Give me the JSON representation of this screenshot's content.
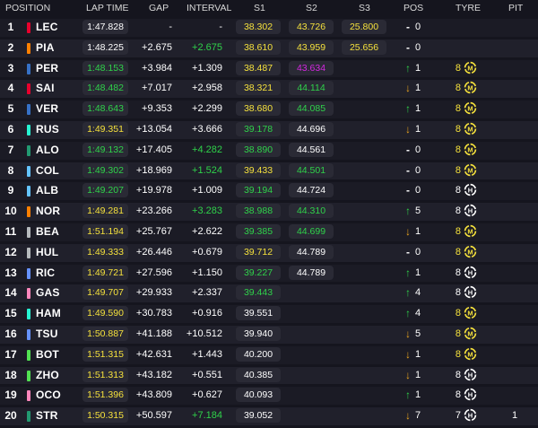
{
  "header": {
    "position": "POSITION",
    "lap_time": "LAP TIME",
    "gap": "GAP",
    "interval": "INTERVAL",
    "s1": "S1",
    "s2": "S2",
    "s3": "S3",
    "pos": "POS",
    "tyre": "TYRE",
    "pit": "PIT"
  },
  "colors": {
    "yellow": "#f5e13c",
    "green": "#2fd24a",
    "purple": "#d427e0",
    "white": "#ffffff",
    "orange": "#e8a31e"
  },
  "team_colors": {
    "ferrari": "#e8002d",
    "mclaren": "#ff8000",
    "redbull": "#3671c6",
    "mercedes": "#27f4d2",
    "aston": "#229971",
    "williams": "#64c4ff",
    "haas": "#b6babd",
    "rb": "#6692ff",
    "alpine": "#ff87bc",
    "sauber": "#52e252"
  },
  "rows": [
    {
      "pos": "1",
      "driver": "LEC",
      "team": "ferrari",
      "lap": "1:47.828",
      "lap_color": "white",
      "gap": "-",
      "gap_color": "white",
      "int": "-",
      "int_color": "white",
      "s1": "38.302",
      "s1_color": "yellow",
      "s2": "43.726",
      "s2_color": "yellow",
      "s3": "25.800",
      "s3_color": "yellow",
      "arrow": "-",
      "arrow_color": "white",
      "posn": "0",
      "tyre_age": "",
      "tyre": "",
      "pit": ""
    },
    {
      "pos": "2",
      "driver": "PIA",
      "team": "mclaren",
      "lap": "1:48.225",
      "lap_color": "white",
      "gap": "+2.675",
      "gap_color": "white",
      "int": "+2.675",
      "int_color": "green",
      "s1": "38.610",
      "s1_color": "yellow",
      "s2": "43.959",
      "s2_color": "yellow",
      "s3": "25.656",
      "s3_color": "yellow",
      "arrow": "-",
      "arrow_color": "white",
      "posn": "0",
      "tyre_age": "",
      "tyre": "",
      "pit": ""
    },
    {
      "pos": "3",
      "driver": "PER",
      "team": "redbull",
      "lap": "1:48.153",
      "lap_color": "green",
      "gap": "+3.984",
      "gap_color": "white",
      "int": "+1.309",
      "int_color": "white",
      "s1": "38.487",
      "s1_color": "yellow",
      "s2": "43.634",
      "s2_color": "purple",
      "s3": "",
      "s3_color": "white",
      "arrow": "↑",
      "arrow_color": "green",
      "posn": "1",
      "tyre_age": "8",
      "tyre": "M",
      "pit": ""
    },
    {
      "pos": "4",
      "driver": "SAI",
      "team": "ferrari",
      "lap": "1:48.482",
      "lap_color": "green",
      "gap": "+7.017",
      "gap_color": "white",
      "int": "+2.958",
      "int_color": "white",
      "s1": "38.321",
      "s1_color": "yellow",
      "s2": "44.114",
      "s2_color": "green",
      "s3": "",
      "s3_color": "white",
      "arrow": "↓",
      "arrow_color": "orange",
      "posn": "1",
      "tyre_age": "8",
      "tyre": "M",
      "pit": ""
    },
    {
      "pos": "5",
      "driver": "VER",
      "team": "redbull",
      "lap": "1:48.643",
      "lap_color": "green",
      "gap": "+9.353",
      "gap_color": "white",
      "int": "+2.299",
      "int_color": "white",
      "s1": "38.680",
      "s1_color": "yellow",
      "s2": "44.085",
      "s2_color": "green",
      "s3": "",
      "s3_color": "white",
      "arrow": "↑",
      "arrow_color": "green",
      "posn": "1",
      "tyre_age": "8",
      "tyre": "M",
      "pit": ""
    },
    {
      "pos": "6",
      "driver": "RUS",
      "team": "mercedes",
      "lap": "1:49.351",
      "lap_color": "yellow",
      "gap": "+13.054",
      "gap_color": "white",
      "int": "+3.666",
      "int_color": "white",
      "s1": "39.178",
      "s1_color": "green",
      "s2": "44.696",
      "s2_color": "white",
      "s3": "",
      "s3_color": "white",
      "arrow": "↓",
      "arrow_color": "orange",
      "posn": "1",
      "tyre_age": "8",
      "tyre": "M",
      "pit": ""
    },
    {
      "pos": "7",
      "driver": "ALO",
      "team": "aston",
      "lap": "1:49.132",
      "lap_color": "green",
      "gap": "+17.405",
      "gap_color": "white",
      "int": "+4.282",
      "int_color": "green",
      "s1": "38.890",
      "s1_color": "green",
      "s2": "44.561",
      "s2_color": "white",
      "s3": "",
      "s3_color": "white",
      "arrow": "-",
      "arrow_color": "white",
      "posn": "0",
      "tyre_age": "8",
      "tyre": "M",
      "pit": ""
    },
    {
      "pos": "8",
      "driver": "COL",
      "team": "williams",
      "lap": "1:49.302",
      "lap_color": "green",
      "gap": "+18.969",
      "gap_color": "white",
      "int": "+1.524",
      "int_color": "green",
      "s1": "39.433",
      "s1_color": "yellow",
      "s2": "44.501",
      "s2_color": "green",
      "s3": "",
      "s3_color": "white",
      "arrow": "-",
      "arrow_color": "white",
      "posn": "0",
      "tyre_age": "8",
      "tyre": "M",
      "pit": ""
    },
    {
      "pos": "9",
      "driver": "ALB",
      "team": "williams",
      "lap": "1:49.207",
      "lap_color": "green",
      "gap": "+19.978",
      "gap_color": "white",
      "int": "+1.009",
      "int_color": "white",
      "s1": "39.194",
      "s1_color": "green",
      "s2": "44.724",
      "s2_color": "white",
      "s3": "",
      "s3_color": "white",
      "arrow": "-",
      "arrow_color": "white",
      "posn": "0",
      "tyre_age": "8",
      "tyre": "H",
      "pit": ""
    },
    {
      "pos": "10",
      "driver": "NOR",
      "team": "mclaren",
      "lap": "1:49.281",
      "lap_color": "yellow",
      "gap": "+23.266",
      "gap_color": "white",
      "int": "+3.283",
      "int_color": "green",
      "s1": "38.988",
      "s1_color": "green",
      "s2": "44.310",
      "s2_color": "green",
      "s3": "",
      "s3_color": "white",
      "arrow": "↑",
      "arrow_color": "green",
      "posn": "5",
      "tyre_age": "8",
      "tyre": "H",
      "pit": ""
    },
    {
      "pos": "11",
      "driver": "BEA",
      "team": "haas",
      "lap": "1:51.194",
      "lap_color": "yellow",
      "gap": "+25.767",
      "gap_color": "white",
      "int": "+2.622",
      "int_color": "white",
      "s1": "39.385",
      "s1_color": "green",
      "s2": "44.699",
      "s2_color": "green",
      "s3": "",
      "s3_color": "white",
      "arrow": "↓",
      "arrow_color": "orange",
      "posn": "1",
      "tyre_age": "8",
      "tyre": "M",
      "pit": ""
    },
    {
      "pos": "12",
      "driver": "HUL",
      "team": "haas",
      "lap": "1:49.333",
      "lap_color": "yellow",
      "gap": "+26.446",
      "gap_color": "white",
      "int": "+0.679",
      "int_color": "white",
      "s1": "39.712",
      "s1_color": "yellow",
      "s2": "44.789",
      "s2_color": "white",
      "s3": "",
      "s3_color": "white",
      "arrow": "-",
      "arrow_color": "white",
      "posn": "0",
      "tyre_age": "8",
      "tyre": "M",
      "pit": ""
    },
    {
      "pos": "13",
      "driver": "RIC",
      "team": "rb",
      "lap": "1:49.721",
      "lap_color": "yellow",
      "gap": "+27.596",
      "gap_color": "white",
      "int": "+1.150",
      "int_color": "white",
      "s1": "39.227",
      "s1_color": "green",
      "s2": "44.789",
      "s2_color": "white",
      "s3": "",
      "s3_color": "white",
      "arrow": "↑",
      "arrow_color": "green",
      "posn": "1",
      "tyre_age": "8",
      "tyre": "H",
      "pit": ""
    },
    {
      "pos": "14",
      "driver": "GAS",
      "team": "alpine",
      "lap": "1:49.707",
      "lap_color": "yellow",
      "gap": "+29.933",
      "gap_color": "white",
      "int": "+2.337",
      "int_color": "white",
      "s1": "39.443",
      "s1_color": "green",
      "s2": "",
      "s2_color": "white",
      "s3": "",
      "s3_color": "white",
      "arrow": "↑",
      "arrow_color": "green",
      "posn": "4",
      "tyre_age": "8",
      "tyre": "H",
      "pit": ""
    },
    {
      "pos": "15",
      "driver": "HAM",
      "team": "mercedes",
      "lap": "1:49.590",
      "lap_color": "yellow",
      "gap": "+30.783",
      "gap_color": "white",
      "int": "+0.916",
      "int_color": "white",
      "s1": "39.551",
      "s1_color": "white",
      "s2": "",
      "s2_color": "white",
      "s3": "",
      "s3_color": "white",
      "arrow": "↑",
      "arrow_color": "green",
      "posn": "4",
      "tyre_age": "8",
      "tyre": "M",
      "pit": ""
    },
    {
      "pos": "16",
      "driver": "TSU",
      "team": "rb",
      "lap": "1:50.887",
      "lap_color": "yellow",
      "gap": "+41.188",
      "gap_color": "white",
      "int": "+10.512",
      "int_color": "white",
      "s1": "39.940",
      "s1_color": "white",
      "s2": "",
      "s2_color": "white",
      "s3": "",
      "s3_color": "white",
      "arrow": "↓",
      "arrow_color": "orange",
      "posn": "5",
      "tyre_age": "8",
      "tyre": "M",
      "pit": ""
    },
    {
      "pos": "17",
      "driver": "BOT",
      "team": "sauber",
      "lap": "1:51.315",
      "lap_color": "yellow",
      "gap": "+42.631",
      "gap_color": "white",
      "int": "+1.443",
      "int_color": "white",
      "s1": "40.200",
      "s1_color": "white",
      "s2": "",
      "s2_color": "white",
      "s3": "",
      "s3_color": "white",
      "arrow": "↓",
      "arrow_color": "orange",
      "posn": "1",
      "tyre_age": "8",
      "tyre": "M",
      "pit": ""
    },
    {
      "pos": "18",
      "driver": "ZHO",
      "team": "sauber",
      "lap": "1:51.313",
      "lap_color": "yellow",
      "gap": "+43.182",
      "gap_color": "white",
      "int": "+0.551",
      "int_color": "white",
      "s1": "40.385",
      "s1_color": "white",
      "s2": "",
      "s2_color": "white",
      "s3": "",
      "s3_color": "white",
      "arrow": "↓",
      "arrow_color": "orange",
      "posn": "1",
      "tyre_age": "8",
      "tyre": "H",
      "pit": ""
    },
    {
      "pos": "19",
      "driver": "OCO",
      "team": "alpine",
      "lap": "1:51.396",
      "lap_color": "yellow",
      "gap": "+43.809",
      "gap_color": "white",
      "int": "+0.627",
      "int_color": "white",
      "s1": "40.093",
      "s1_color": "white",
      "s2": "",
      "s2_color": "white",
      "s3": "",
      "s3_color": "white",
      "arrow": "↑",
      "arrow_color": "green",
      "posn": "1",
      "tyre_age": "8",
      "tyre": "H",
      "pit": ""
    },
    {
      "pos": "20",
      "driver": "STR",
      "team": "aston",
      "lap": "1:50.315",
      "lap_color": "yellow",
      "gap": "+50.597",
      "gap_color": "white",
      "int": "+7.184",
      "int_color": "green",
      "s1": "39.052",
      "s1_color": "white",
      "s2": "",
      "s2_color": "white",
      "s3": "",
      "s3_color": "white",
      "arrow": "↓",
      "arrow_color": "orange",
      "posn": "7",
      "tyre_age": "7",
      "tyre": "H",
      "pit": "1"
    }
  ]
}
